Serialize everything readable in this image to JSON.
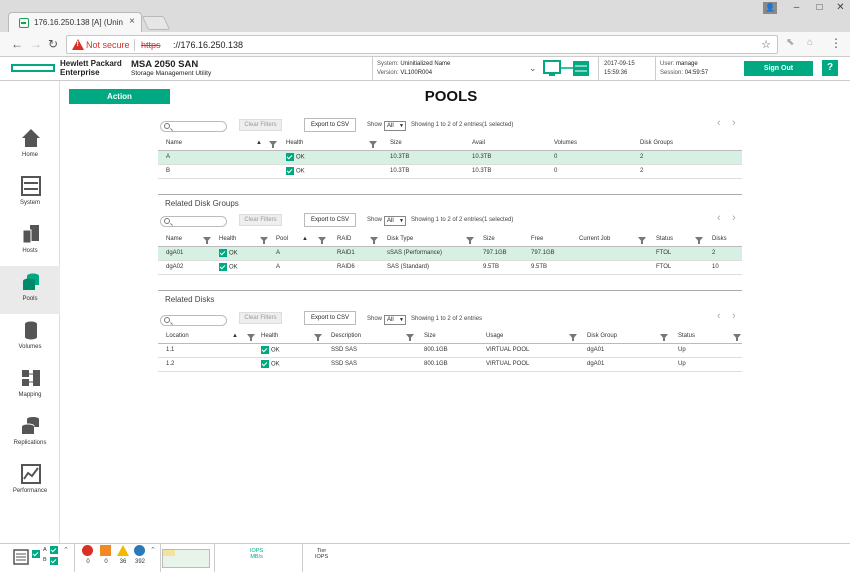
{
  "browser": {
    "tab_title": "176.16.250.138 [A] (Unin",
    "not_secure": "Not secure",
    "url_scheme": "https",
    "url_rest": "://176.16.250.138"
  },
  "header": {
    "brand_line1": "Hewlett Packard",
    "brand_line2": "Enterprise",
    "product": "MSA 2050 SAN",
    "product_sub": "Storage Management Utility",
    "system_label": "System:",
    "system_value": "Uninitialized Name",
    "version_label": "Version:",
    "version_value": "VL100R004",
    "date": "2017-09-15",
    "time": "15:59:36",
    "user_label": "User:",
    "user_value": "manage",
    "session_label": "Session:",
    "session_value": "04:59:57",
    "signout": "Sign Out",
    "help": "?",
    "accent": "#01a982"
  },
  "nav": [
    {
      "label": "Home",
      "icon": "home-icon"
    },
    {
      "label": "System",
      "icon": "system-icon"
    },
    {
      "label": "Hosts",
      "icon": "hosts-icon"
    },
    {
      "label": "Pools",
      "icon": "pools-icon",
      "active": true
    },
    {
      "label": "Volumes",
      "icon": "volumes-icon"
    },
    {
      "label": "Mapping",
      "icon": "mapping-icon"
    },
    {
      "label": "Replications",
      "icon": "replications-icon"
    },
    {
      "label": "Performance",
      "icon": "performance-icon"
    }
  ],
  "main": {
    "action": "Action",
    "title": "POOLS",
    "clear_filters": "Clear Filters",
    "export_csv": "Export to CSV",
    "show_label": "Show",
    "show_value": "All",
    "pools": {
      "entries": "Showing 1 to 2 of 2 entries(1 selected)",
      "headers": [
        "Name",
        "Health",
        "Size",
        "Avail",
        "Volumes",
        "Disk Groups"
      ],
      "rows": [
        {
          "name": "A",
          "health": "OK",
          "size": "10.3TB",
          "avail": "10.3TB",
          "volumes": "0",
          "disk_groups": "2",
          "selected": true
        },
        {
          "name": "B",
          "health": "OK",
          "size": "10.3TB",
          "avail": "10.3TB",
          "volumes": "0",
          "disk_groups": "2"
        }
      ]
    },
    "disk_groups": {
      "title": "Related Disk Groups",
      "entries": "Showing 1 to 2 of 2 entries(1 selected)",
      "headers": [
        "Name",
        "Health",
        "Pool",
        "RAID",
        "Disk Type",
        "Size",
        "Free",
        "Current Job",
        "Status",
        "Disks"
      ],
      "rows": [
        {
          "name": "dgA01",
          "health": "OK",
          "pool": "A",
          "raid": "RAID1",
          "disk_type": "sSAS (Performance)",
          "size": "797.1GB",
          "free": "797.1GB",
          "job": "",
          "status": "FTOL",
          "disks": "2",
          "selected": true
        },
        {
          "name": "dgA02",
          "health": "OK",
          "pool": "A",
          "raid": "RAID6",
          "disk_type": "SAS (Standard)",
          "size": "9.5TB",
          "free": "9.5TB",
          "job": "",
          "status": "FTOL",
          "disks": "10"
        }
      ]
    },
    "disks": {
      "title": "Related Disks",
      "entries": "Showing 1 to 2 of 2 entries",
      "headers": [
        "Location",
        "Health",
        "Description",
        "Size",
        "Usage",
        "Disk Group",
        "Status"
      ],
      "rows": [
        {
          "location": "1.1",
          "health": "OK",
          "description": "SSD SAS",
          "size": "800.1GB",
          "usage": "VIRTUAL POOL",
          "disk_group": "dgA01",
          "status": "Up"
        },
        {
          "location": "1.2",
          "health": "OK",
          "description": "SSD SAS",
          "size": "800.1GB",
          "usage": "VIRTUAL POOL",
          "disk_group": "dgA01",
          "status": "Up"
        }
      ]
    }
  },
  "footer": {
    "ctrl_a": "A",
    "ctrl_b": "B",
    "critical": "0",
    "error": "0",
    "warning": "36",
    "info": "392",
    "iops_label": "IOPS",
    "mbs_label": "MB/s",
    "tier_label": "Tier",
    "tier_iops": "IOPS"
  }
}
